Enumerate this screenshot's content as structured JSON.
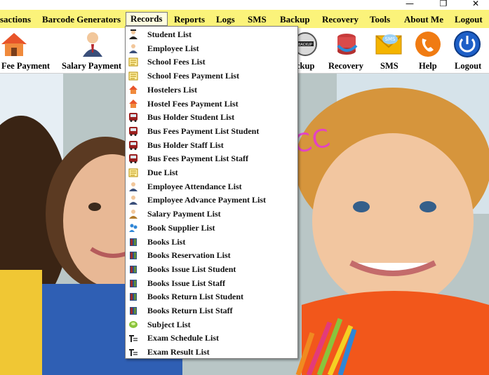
{
  "window": {
    "min_icon": "minimize-icon",
    "max_icon": "maximize-icon",
    "close_icon": "close-icon",
    "min_glyph": "—",
    "max_glyph": "❐",
    "close_glyph": "✕"
  },
  "menubar": {
    "items": [
      "sactions",
      "Barcode Generators",
      "Records",
      "Reports",
      "Logs",
      "SMS",
      "Backup",
      "Recovery",
      "Tools",
      "About Me",
      "Logout"
    ],
    "active": "Records"
  },
  "toolbar": {
    "buttons": [
      {
        "label": "Fee Payment",
        "icon": "house-icon"
      },
      {
        "label": "Salary Payment",
        "icon": "businessman-icon"
      },
      {
        "label": "ckup",
        "icon": "backup-disk-icon"
      },
      {
        "label": "Recovery",
        "icon": "database-recovery-icon"
      },
      {
        "label": "SMS",
        "icon": "sms-envelope-icon"
      },
      {
        "label": "Help",
        "icon": "phone-help-icon"
      },
      {
        "label": "Logout",
        "icon": "power-icon"
      }
    ]
  },
  "dropdown": {
    "items": [
      {
        "label": "Student List",
        "icon": "student-icon"
      },
      {
        "label": "Employee List",
        "icon": "employee-icon"
      },
      {
        "label": "School Fees List",
        "icon": "fees-ledger-icon"
      },
      {
        "label": "School Fees Payment List",
        "icon": "fees-ledger-icon"
      },
      {
        "label": "Hostelers List",
        "icon": "house-icon"
      },
      {
        "label": "Hostel Fees Payment List",
        "icon": "house-icon"
      },
      {
        "label": "Bus Holder Student List",
        "icon": "bus-icon"
      },
      {
        "label": "Bus Fees Payment List Student",
        "icon": "bus-icon"
      },
      {
        "label": "Bus Holder Staff List",
        "icon": "bus-icon"
      },
      {
        "label": "Bus Fees Payment List Staff",
        "icon": "bus-icon"
      },
      {
        "label": "Due List",
        "icon": "fees-ledger-icon"
      },
      {
        "label": "Employee Attendance List",
        "icon": "employee-icon"
      },
      {
        "label": "Employee Advance Payment List",
        "icon": "employee-icon"
      },
      {
        "label": "Salary Payment List",
        "icon": "salary-person-icon"
      },
      {
        "label": "Book Supplier List",
        "icon": "supplier-icon"
      },
      {
        "label": "Books List",
        "icon": "book-icon"
      },
      {
        "label": "Books Reservation List",
        "icon": "book-icon"
      },
      {
        "label": "Books Issue List Student",
        "icon": "book-icon"
      },
      {
        "label": "Books Issue List Staff",
        "icon": "book-icon"
      },
      {
        "label": "Books Return List Student",
        "icon": "book-icon"
      },
      {
        "label": "Books Return List Staff",
        "icon": "book-icon"
      },
      {
        "label": "Subject List",
        "icon": "subject-icon"
      },
      {
        "label": "Exam Schedule List",
        "icon": "exam-icon"
      },
      {
        "label": "Exam Result List",
        "icon": "exam-icon"
      }
    ]
  },
  "watermark": "CODELIST.CC",
  "colors": {
    "menubar": "#fbf37a",
    "accent_magenta": "#e53ccf"
  }
}
